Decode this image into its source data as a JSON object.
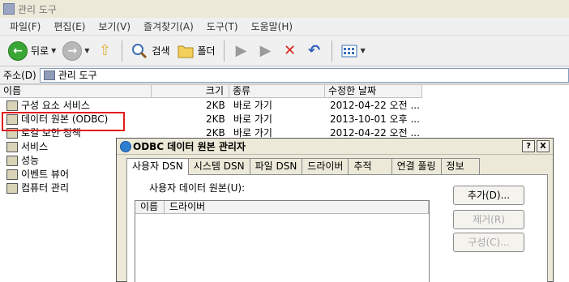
{
  "window": {
    "title": "관리 도구"
  },
  "menu": [
    "파일(F)",
    "편집(E)",
    "보기(V)",
    "즐겨찾기(A)",
    "도구(T)",
    "도움말(H)"
  ],
  "toolbar": {
    "back_label": "뒤로",
    "search_label": "검색",
    "folders_label": "폴더"
  },
  "address": {
    "label": "주소(D)",
    "value": "관리 도구"
  },
  "columns": {
    "name": "이름",
    "size": "크기",
    "type": "종류",
    "modified": "수정한 날짜"
  },
  "files": [
    {
      "name": "구성 요소 서비스",
      "size": "2KB",
      "type": "바로 가기",
      "modified": "2012-04-22 오전 ..."
    },
    {
      "name": "데이터 원본 (ODBC)",
      "size": "2KB",
      "type": "바로 가기",
      "modified": "2013-10-01 오후 ..."
    },
    {
      "name": "로컬 보안 정책",
      "size": "2KB",
      "type": "바로 가기",
      "modified": "2012-04-22 오전 ..."
    },
    {
      "name": "서비스",
      "size": "",
      "type": "",
      "modified": ""
    },
    {
      "name": "성능",
      "size": "",
      "type": "",
      "modified": ""
    },
    {
      "name": "이벤트 뷰어",
      "size": "",
      "type": "",
      "modified": ""
    },
    {
      "name": "컴퓨터 관리",
      "size": "",
      "type": "",
      "modified": ""
    }
  ],
  "dialog": {
    "title": "ODBC 데이터 원본 관리자",
    "help_button": "?",
    "close_button": "X",
    "tabs": [
      "사용자 DSN",
      "시스템 DSN",
      "파일 DSN",
      "드라이버",
      "추적",
      "연결 풀링",
      "정보"
    ],
    "user_dsn_label": "사용자 데이터 원본(U):",
    "list_columns": [
      "이름",
      "드라이버"
    ],
    "buttons": {
      "add": "추가(D)...",
      "remove": "제거(R)",
      "configure": "구성(C)..."
    }
  }
}
